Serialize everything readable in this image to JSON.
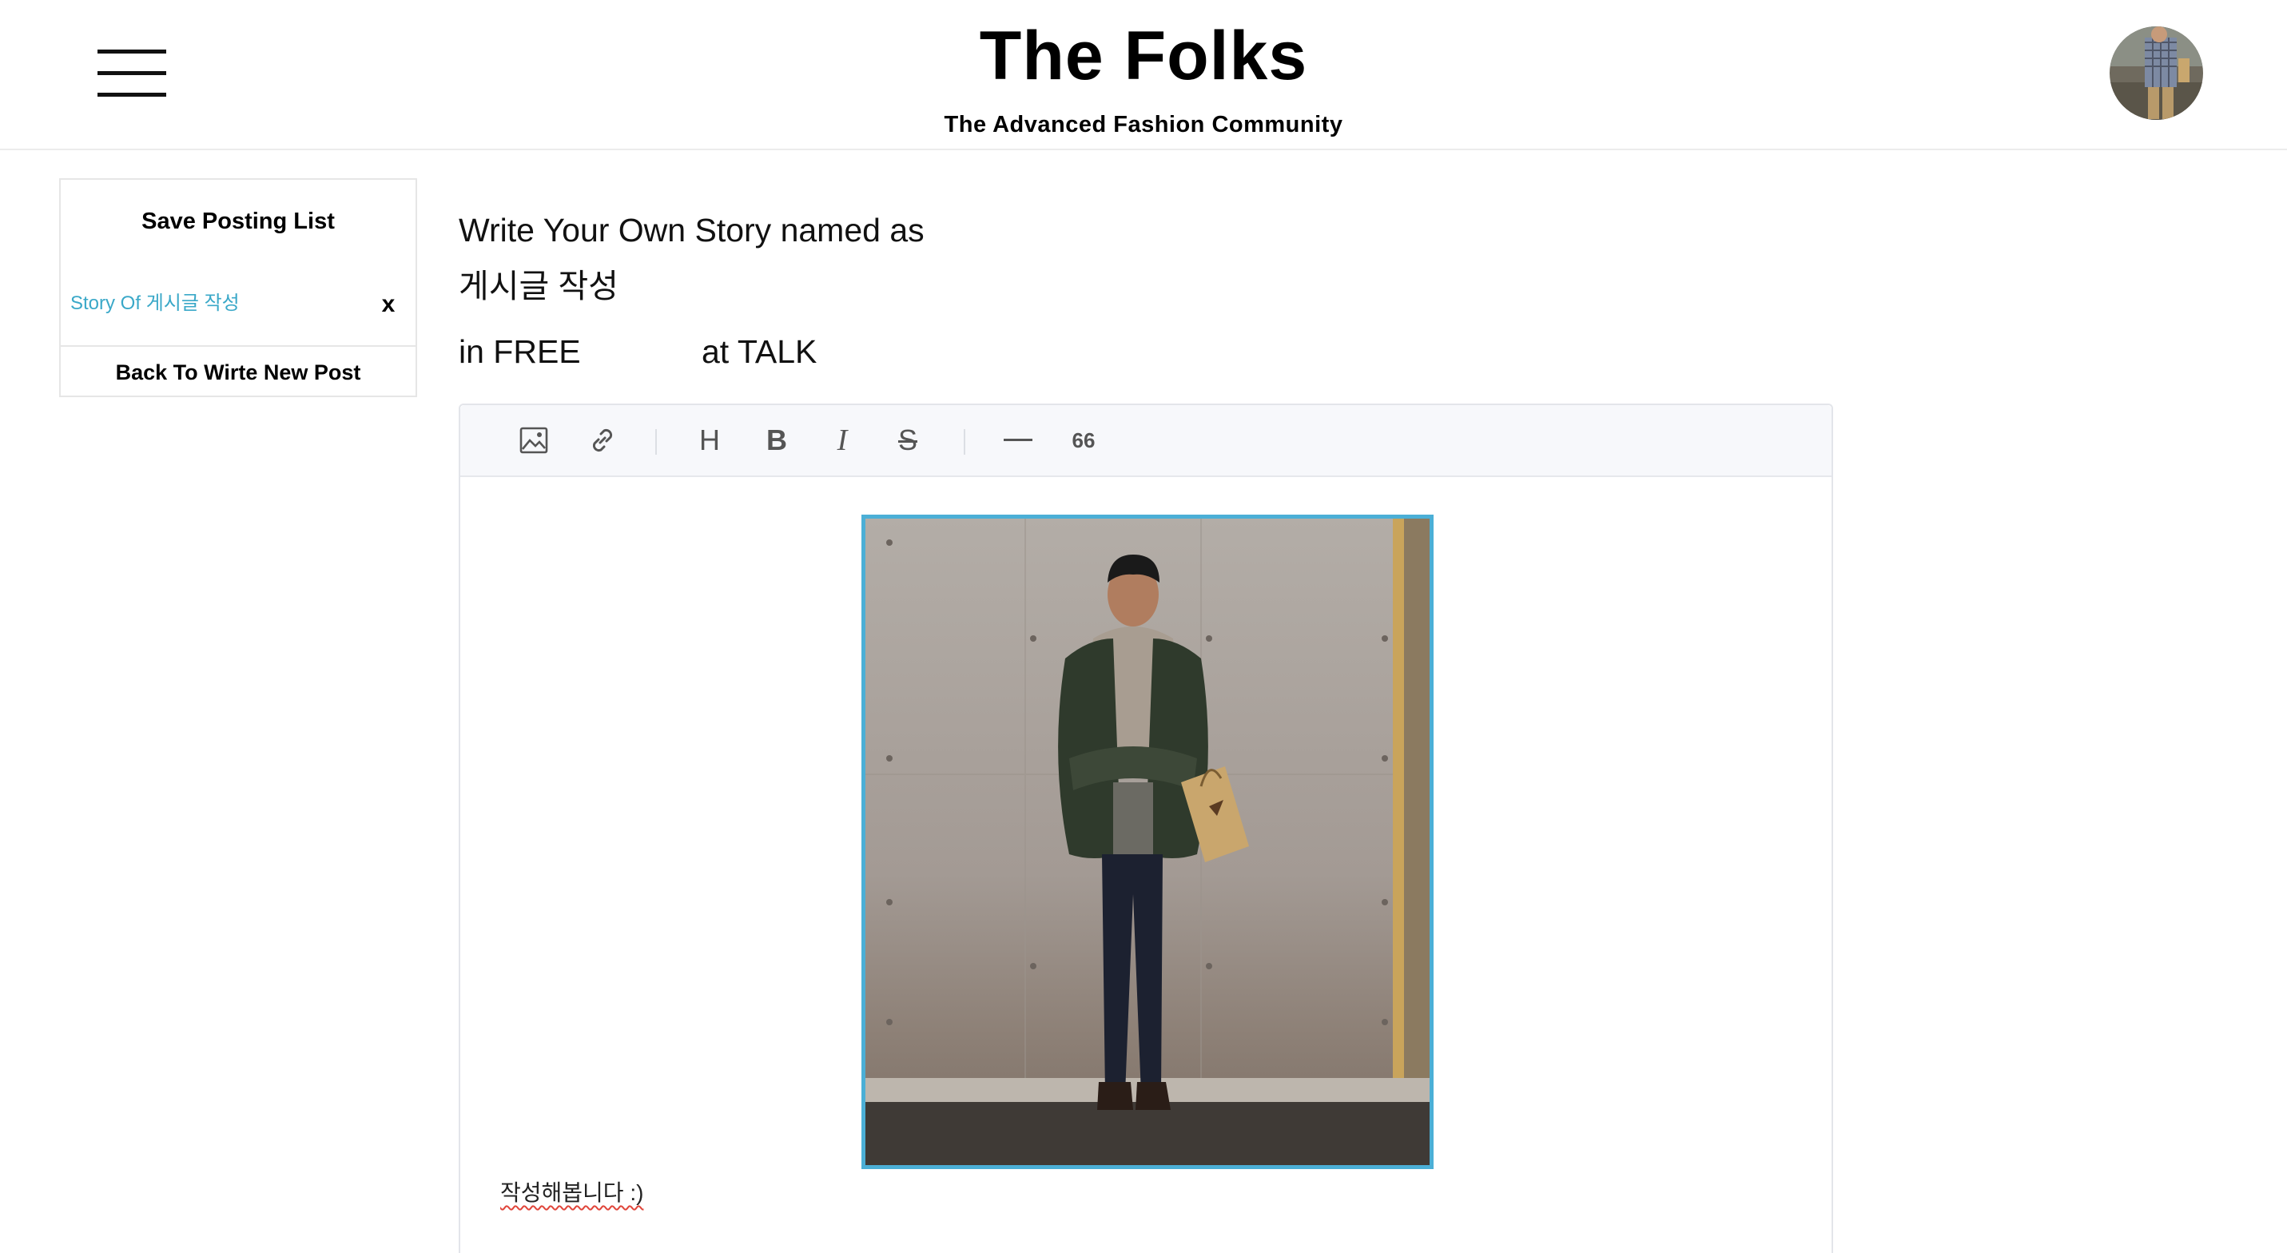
{
  "header": {
    "title": "The Folks",
    "subtitle": "The Advanced Fashion Community",
    "menu_icon": "hamburger-menu-icon",
    "avatar": "user-avatar"
  },
  "sidebar": {
    "title": "Save Posting List",
    "saved_items": [
      {
        "label": "Story Of 게시글 작성",
        "remove_label": "x"
      }
    ],
    "back_label": "Back To Wirte New Post",
    "link_color": "#3aa8c8"
  },
  "main": {
    "heading_line1": "Write Your Own Story named as",
    "post_title": "게시글 작성",
    "board_text": "in FREE",
    "category_text": "at TALK"
  },
  "editor": {
    "toolbar": [
      {
        "icon": "image-icon"
      },
      {
        "icon": "link-icon"
      },
      {
        "icon": "heading-icon",
        "text": "H"
      },
      {
        "icon": "bold-icon",
        "text": "B"
      },
      {
        "icon": "italic-icon",
        "text": "I"
      },
      {
        "icon": "strikethrough-icon",
        "text": "S"
      },
      {
        "icon": "horizontal-rule-icon"
      },
      {
        "icon": "quote-icon",
        "text": "66"
      }
    ],
    "selected_border_color": "#4bafd6",
    "body_text": "작성해봅니다 :)"
  }
}
